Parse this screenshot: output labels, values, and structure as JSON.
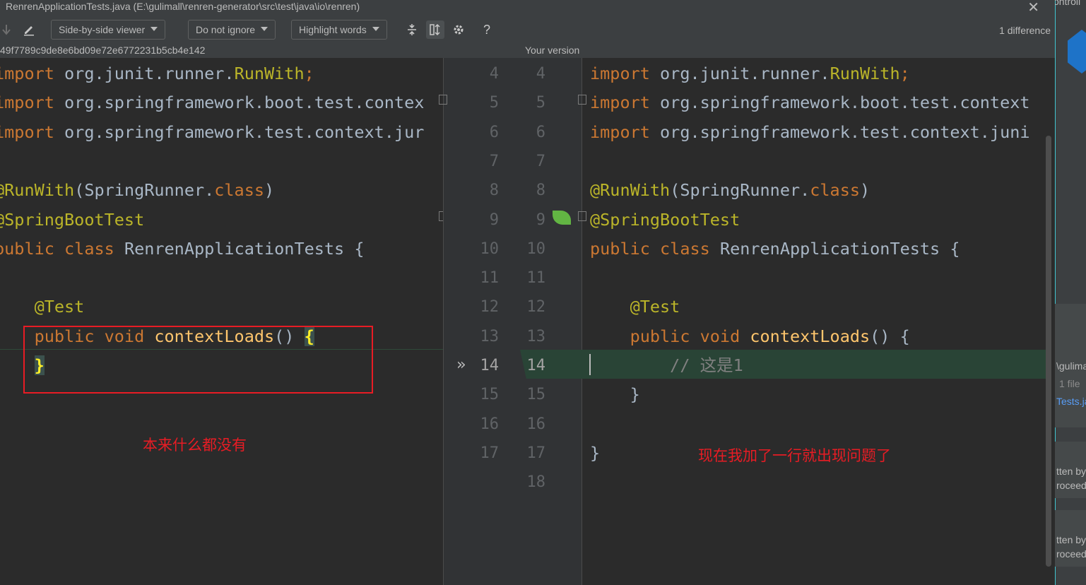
{
  "window": {
    "title": "RenrenApplicationTests.java (E:\\gulimall\\renren-generator\\src\\test\\java\\io\\renren)",
    "close_glyph": "✕"
  },
  "toolbar": {
    "viewer": "Side-by-side viewer",
    "ignore": "Do not ignore",
    "highlight": "Highlight words",
    "help": "?",
    "difference_count": "1 difference"
  },
  "infobar": {
    "left_revision": "49f7789c9de8e6bd09e72e6772231b5cb4e142",
    "right_label": "Your version"
  },
  "left_code": [
    {
      "segments": [
        {
          "t": "import",
          "c": "kw"
        },
        {
          "t": " org.junit.runner.",
          "c": "id"
        },
        {
          "t": "RunWith",
          "c": "ann"
        },
        {
          "t": ";",
          "c": "kw"
        }
      ]
    },
    {
      "segments": [
        {
          "t": "import",
          "c": "kw"
        },
        {
          "t": " org.springframework.boot.test.contex",
          "c": "id"
        }
      ]
    },
    {
      "segments": [
        {
          "t": "import",
          "c": "kw"
        },
        {
          "t": " org.springframework.test.context.jur",
          "c": "id"
        }
      ]
    },
    {
      "segments": []
    },
    {
      "segments": [
        {
          "t": "@RunWith",
          "c": "ann"
        },
        {
          "t": "(SpringRunner.",
          "c": "id"
        },
        {
          "t": "class",
          "c": "kw"
        },
        {
          "t": ")",
          "c": "id"
        }
      ]
    },
    {
      "segments": [
        {
          "t": "@SpringBootTest",
          "c": "ann"
        }
      ]
    },
    {
      "segments": [
        {
          "t": "public class ",
          "c": "kw"
        },
        {
          "t": "RenrenApplicationTests {",
          "c": "id"
        }
      ]
    },
    {
      "segments": []
    },
    {
      "segments": [
        {
          "t": "    @Test",
          "c": "ann"
        }
      ]
    },
    {
      "segments": [
        {
          "t": "    public void ",
          "c": "kw"
        },
        {
          "t": "contextLoads",
          "c": "fn"
        },
        {
          "t": "() ",
          "c": "id"
        },
        {
          "t": "{",
          "c": "bracehl"
        }
      ]
    },
    {
      "segments": [
        {
          "t": "    ",
          "c": "id"
        },
        {
          "t": "}",
          "c": "bracehl"
        }
      ]
    }
  ],
  "right_code": [
    {
      "segments": [
        {
          "t": "import",
          "c": "kw"
        },
        {
          "t": " org.junit.runner.",
          "c": "id"
        },
        {
          "t": "RunWith",
          "c": "ann"
        },
        {
          "t": ";",
          "c": "kw"
        }
      ]
    },
    {
      "segments": [
        {
          "t": "import",
          "c": "kw"
        },
        {
          "t": " org.springframework.boot.test.context",
          "c": "id"
        }
      ]
    },
    {
      "segments": [
        {
          "t": "import",
          "c": "kw"
        },
        {
          "t": " org.springframework.test.context.juni",
          "c": "id"
        }
      ]
    },
    {
      "segments": []
    },
    {
      "segments": [
        {
          "t": "@RunWith",
          "c": "ann"
        },
        {
          "t": "(SpringRunner.",
          "c": "id"
        },
        {
          "t": "class",
          "c": "kw"
        },
        {
          "t": ")",
          "c": "id"
        }
      ]
    },
    {
      "segments": [
        {
          "t": "@SpringBootTest",
          "c": "ann"
        }
      ]
    },
    {
      "segments": [
        {
          "t": "public class ",
          "c": "kw"
        },
        {
          "t": "RenrenApplicationTests {",
          "c": "id"
        }
      ]
    },
    {
      "segments": []
    },
    {
      "segments": [
        {
          "t": "    @Test",
          "c": "ann"
        }
      ]
    },
    {
      "segments": [
        {
          "t": "    public void ",
          "c": "kw"
        },
        {
          "t": "contextLoads",
          "c": "fn"
        },
        {
          "t": "() {",
          "c": "id"
        }
      ]
    },
    {
      "segments": [
        {
          "t": "        // 这是1",
          "c": "cm"
        }
      ]
    },
    {
      "segments": [
        {
          "t": "    }",
          "c": "id"
        }
      ]
    },
    {
      "segments": []
    },
    {
      "segments": [
        {
          "t": "}",
          "c": "id"
        }
      ]
    }
  ],
  "left_line_numbers": [
    "4",
    "5",
    "6",
    "7",
    "8",
    "9",
    "10",
    "11",
    "12",
    "13",
    "14",
    "15",
    "16",
    "17"
  ],
  "right_line_numbers": [
    "4",
    "5",
    "6",
    "7",
    "8",
    "9",
    "10",
    "11",
    "12",
    "13",
    "14",
    "15",
    "16",
    "17",
    "18"
  ],
  "current_line": "14",
  "annotations": {
    "left_note": "本来什么都没有",
    "right_note": "现在我加了一行就出现问题了"
  },
  "sidestrip": {
    "top_text": "ontroll",
    "repo_text": "\\gulima",
    "file_count": "1 file",
    "file_name": "Tests.ja",
    "card1_line1": "tten by",
    "card1_line2": "roceed",
    "card2_line1": "tten by",
    "card2_line2": "roceed"
  }
}
